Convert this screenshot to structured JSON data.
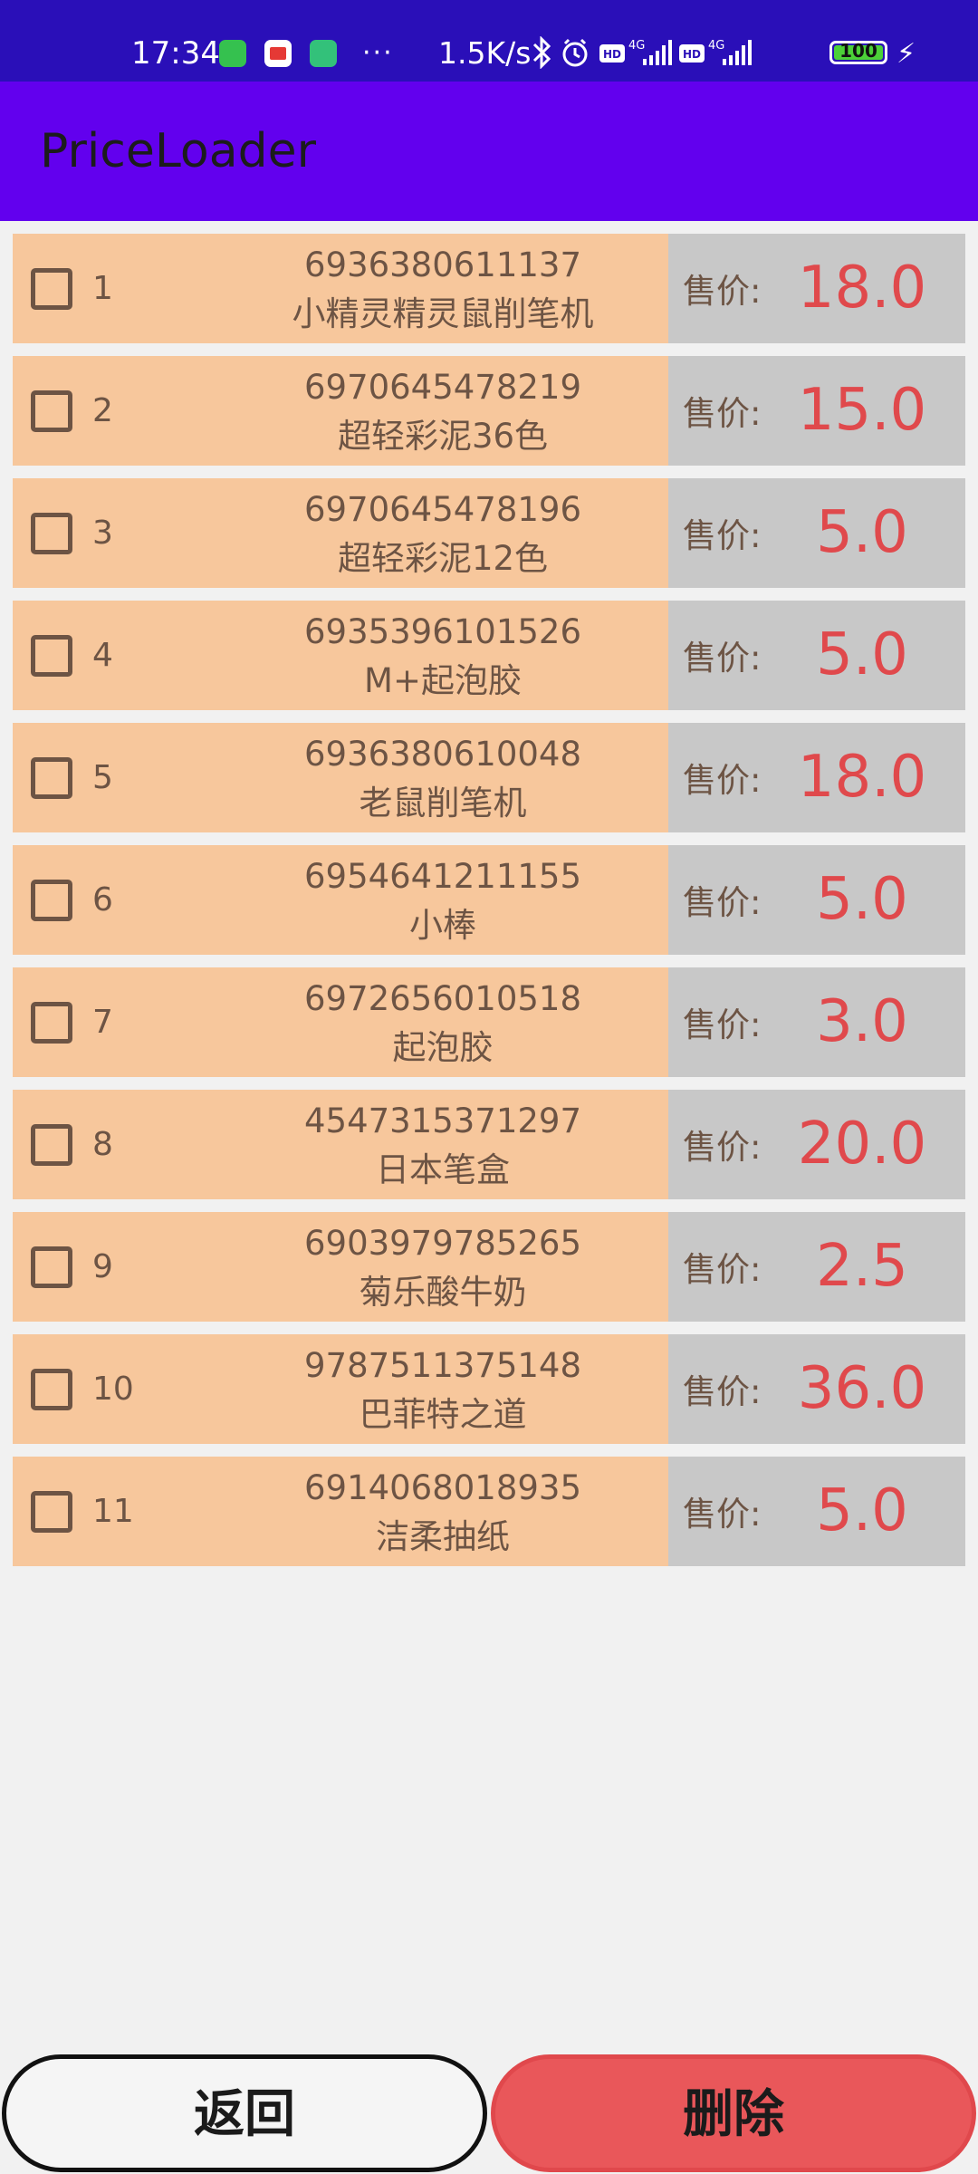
{
  "status_bar": {
    "time": "17:34",
    "more": "···",
    "speed": "1.5K/s",
    "battery": "100"
  },
  "app_bar": {
    "title": "PriceLoader"
  },
  "price_label": "售价:",
  "items": [
    {
      "index": "1",
      "code": "6936380611137",
      "name": "小精灵精灵鼠削笔机",
      "price": "18.0"
    },
    {
      "index": "2",
      "code": "6970645478219",
      "name": "超轻彩泥36色",
      "price": "15.0"
    },
    {
      "index": "3",
      "code": "6970645478196",
      "name": "超轻彩泥12色",
      "price": "5.0"
    },
    {
      "index": "4",
      "code": "6935396101526",
      "name": "M+起泡胶",
      "price": "5.0"
    },
    {
      "index": "5",
      "code": "6936380610048",
      "name": "老鼠削笔机",
      "price": "18.0"
    },
    {
      "index": "6",
      "code": "6954641211155",
      "name": "小棒",
      "price": "5.0"
    },
    {
      "index": "7",
      "code": "6972656010518",
      "name": "起泡胶",
      "price": "3.0"
    },
    {
      "index": "8",
      "code": "4547315371297",
      "name": "日本笔盒",
      "price": "20.0"
    },
    {
      "index": "9",
      "code": "6903979785265",
      "name": "菊乐酸牛奶",
      "price": "2.5"
    },
    {
      "index": "10",
      "code": "9787511375148",
      "name": "巴菲特之道",
      "price": "36.0"
    },
    {
      "index": "11",
      "code": "6914068018935",
      "name": "洁柔抽纸",
      "price": "5.0"
    }
  ],
  "buttons": {
    "back": "返回",
    "delete": "删除"
  },
  "colors": {
    "status_bar": "#2a0fb8",
    "app_bar": "#6200ee",
    "row_left": "#f7c79c",
    "row_right": "#c8c8c8",
    "price": "#e0494c",
    "delete_button": "#e9575a"
  }
}
